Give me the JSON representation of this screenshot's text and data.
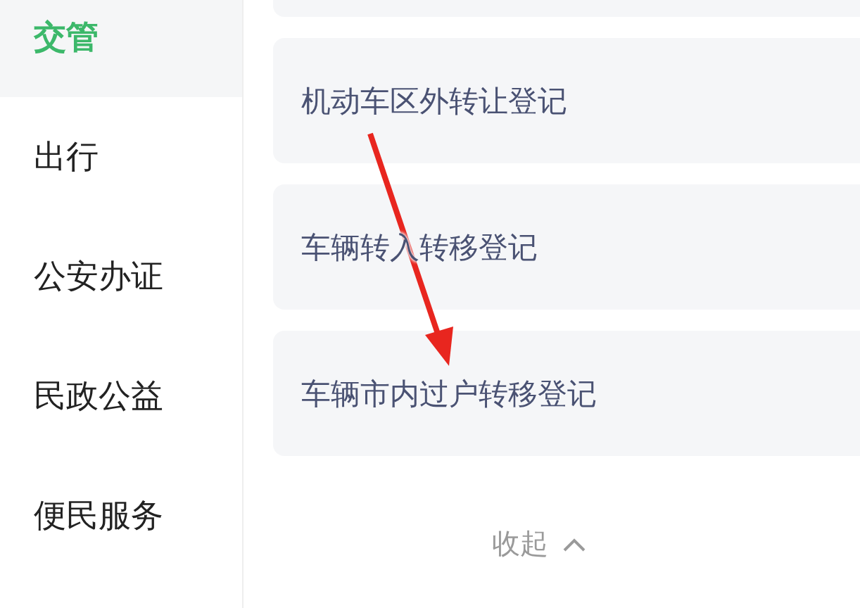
{
  "sidebar": {
    "items": [
      {
        "label": "交管",
        "selected": true
      },
      {
        "label": "出行",
        "selected": false
      },
      {
        "label": "公安办证",
        "selected": false
      },
      {
        "label": "民政公益",
        "selected": false
      },
      {
        "label": "便民服务",
        "selected": false
      }
    ]
  },
  "cards": [
    {
      "title": "机动车区外转让登记"
    },
    {
      "title": "车辆转入转移登记"
    },
    {
      "title": "车辆市内过户转移登记"
    }
  ],
  "collapse": {
    "label": "收起"
  },
  "annotations": [
    {
      "kind": "arrow"
    }
  ]
}
